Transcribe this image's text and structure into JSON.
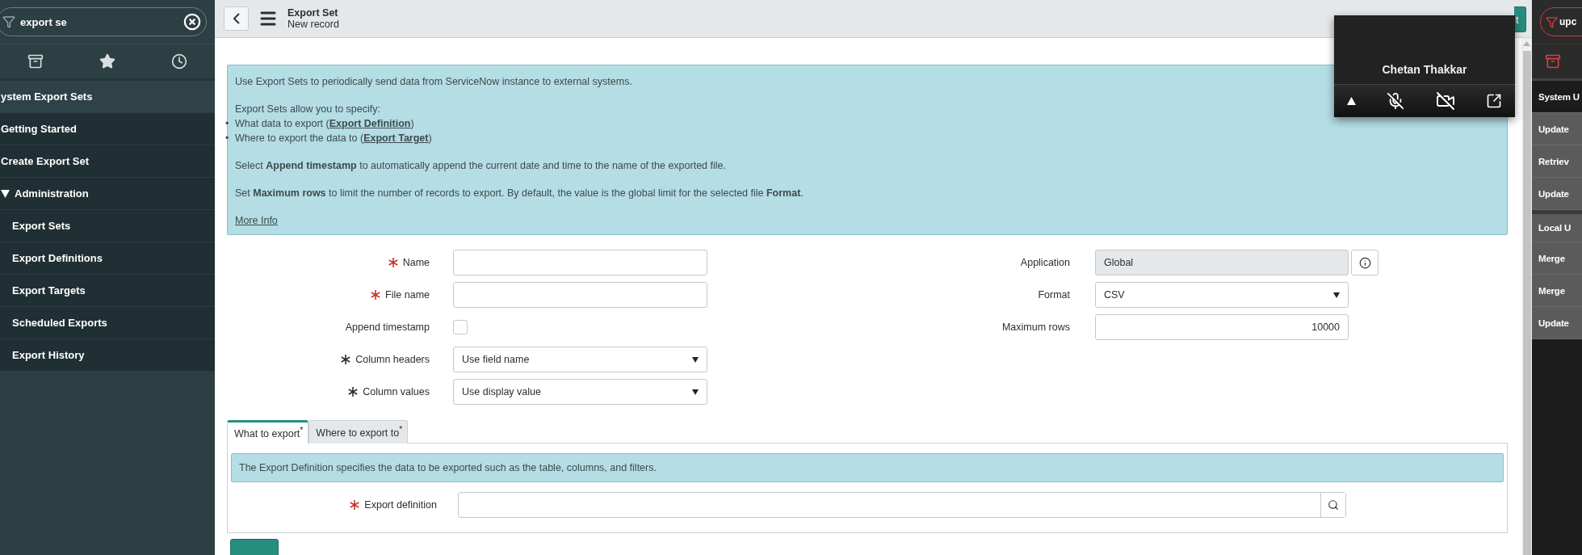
{
  "nav_filter": {
    "value": "export se"
  },
  "nav_items": [
    {
      "label": "ystem Export Sets",
      "kind": "application"
    },
    {
      "label": "Getting Started",
      "kind": "module"
    },
    {
      "label": "Create Export Set",
      "kind": "module"
    },
    {
      "label": "Administration",
      "kind": "separator",
      "expanded": true,
      "children": [
        {
          "label": "Export Sets",
          "kind": "module"
        },
        {
          "label": "Export Definitions",
          "kind": "module"
        },
        {
          "label": "Export Targets",
          "kind": "module"
        },
        {
          "label": "Scheduled Exports",
          "kind": "module"
        },
        {
          "label": "Export History",
          "kind": "module"
        }
      ]
    }
  ],
  "header": {
    "title": "Export Set",
    "subtitle": "New record",
    "action_button": "t"
  },
  "info": {
    "blocks": [
      [
        {
          "kind": "text",
          "text": "Use Export Sets to periodically send data from ServiceNow instance to external systems."
        }
      ],
      [
        {
          "kind": "text",
          "text": "Export Sets allow you to specify:"
        },
        {
          "kind": "bullet",
          "marker": "•",
          "before": "What data to export (",
          "link": "Export Definition",
          "after": ")"
        },
        {
          "kind": "bullet",
          "marker": "•",
          "before": "Where to export the data to (",
          "link": "Export Target",
          "after": ")"
        }
      ],
      [
        {
          "kind": "text",
          "text": "Select **Append timestamp** to automatically append the current date and time to the name of the exported file."
        }
      ],
      [
        {
          "kind": "text",
          "text": "Set **Maximum rows** to limit the number of records to export. By default, the value is the global limit for the selected file **Format**."
        }
      ],
      [
        {
          "kind": "link",
          "text": "More Info"
        }
      ]
    ]
  },
  "form": {
    "left": [
      {
        "label": "Name",
        "kind": "text",
        "required": true,
        "satisfied": false
      },
      {
        "label": "File name",
        "kind": "text",
        "required": true,
        "satisfied": false
      },
      {
        "label": "Append timestamp",
        "kind": "checkbox",
        "required": false,
        "checked": false
      },
      {
        "label": "Column headers",
        "kind": "select",
        "required": true,
        "satisfied": true,
        "value": "Use field name"
      },
      {
        "label": "Column values",
        "kind": "select",
        "required": true,
        "satisfied": true,
        "value": "Use display value"
      }
    ],
    "right": [
      {
        "label": "Application",
        "kind": "readonly",
        "required": false,
        "value": "Global"
      },
      {
        "label": "Format",
        "kind": "select",
        "required": false,
        "value": "CSV"
      },
      {
        "label": "Maximum rows",
        "kind": "number",
        "required": false,
        "value": "10000"
      }
    ]
  },
  "tabs": [
    {
      "label": "What to export$^{*}$",
      "selected": true
    },
    {
      "label": "Where to export to$^{*}$",
      "selected": false
    }
  ],
  "tab_panel": {
    "note": "The Export Definition specifies the data to be exported such as the table, columns, and filters.",
    "fields": [
      {
        "label": "Export definition",
        "kind": "reference",
        "required": true,
        "satisfied": false
      }
    ]
  },
  "call_overlay": {
    "participant": "Chetan Thakkar",
    "mic_muted": true,
    "video_off": true
  },
  "right_nav": {
    "filter": "upc",
    "items": [
      {
        "label": "System U",
        "kind": "application",
        "section_start": false
      },
      {
        "label": "Update",
        "kind": "module",
        "section_start": false
      },
      {
        "label": "Retriev",
        "kind": "module",
        "section_start": false
      },
      {
        "label": "Update",
        "kind": "module",
        "section_start": false
      },
      {
        "label": "Local U",
        "kind": "module",
        "section_start": true
      },
      {
        "label": "Merge",
        "kind": "module",
        "section_start": false
      },
      {
        "label": "Merge",
        "kind": "module",
        "section_start": false
      },
      {
        "label": "Update",
        "kind": "module",
        "section_start": false
      }
    ]
  }
}
